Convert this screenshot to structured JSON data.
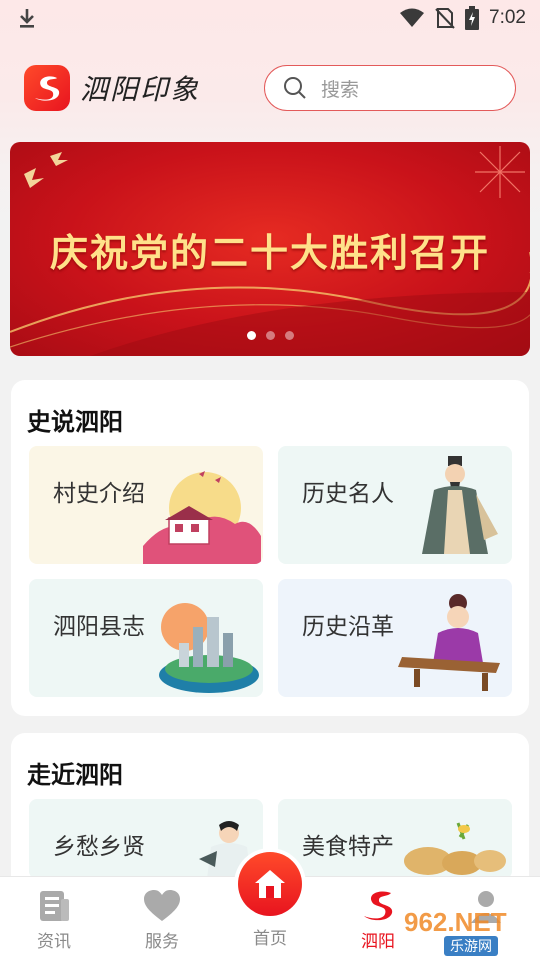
{
  "status_bar": {
    "time": "7:02",
    "icons": [
      "download-icon",
      "wifi-icon",
      "no-sim-icon",
      "battery-charging-icon"
    ]
  },
  "header": {
    "app_name": "泗阳印象",
    "search_placeholder": "搜索"
  },
  "banner": {
    "title": "庆祝党的二十大胜利召开",
    "slide_count": 3,
    "active_slide": 1
  },
  "sections": [
    {
      "title": "史说泗阳",
      "cards": [
        {
          "label": "村史介绍",
          "icon": "village-landscape-illustration"
        },
        {
          "label": "历史名人",
          "icon": "historical-figure-illustration"
        },
        {
          "label": "泗阳县志",
          "icon": "county-island-illustration"
        },
        {
          "label": "历史沿革",
          "icon": "guzheng-player-illustration"
        }
      ]
    },
    {
      "title": "走近泗阳",
      "cards": [
        {
          "label": "乡愁乡贤",
          "icon": "scholar-illustration"
        },
        {
          "label": "美食特产",
          "icon": "peanut-food-illustration"
        }
      ]
    }
  ],
  "bottom_nav": [
    {
      "label": "资讯",
      "icon": "news-icon",
      "active": false
    },
    {
      "label": "服务",
      "icon": "heart-icon",
      "active": false
    },
    {
      "label": "首页",
      "icon": "home-icon",
      "active": false
    },
    {
      "label": "泗阳",
      "icon": "siyang-logo-icon",
      "active": true
    },
    {
      "label": "",
      "icon": "profile-icon",
      "active": false
    }
  ],
  "watermark": {
    "line1": "962.NET",
    "line2": "乐游网"
  },
  "colors": {
    "brand_red": "#e8141f",
    "banner_gold": "#ffe18a",
    "search_border": "#e35a5a"
  }
}
